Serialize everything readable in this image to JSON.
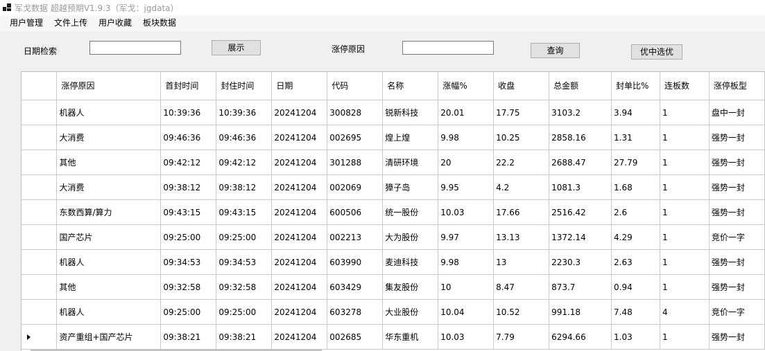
{
  "window": {
    "title": "军戈数据 超越预期V1.9.3（军戈：jgdata）"
  },
  "menu": {
    "items": [
      "用户管理",
      "文件上传",
      "用户收藏",
      "板块数据"
    ]
  },
  "search": {
    "date_label": "日期检索",
    "date_value": "",
    "show_button": "展示",
    "reason_label": "涨停原因",
    "reason_value": "",
    "query_button": "查询",
    "optimize_button": "优中选优"
  },
  "grid": {
    "columns": [
      "涨停原因",
      "首封时间",
      "封住时间",
      "日期",
      "代码",
      "名称",
      "涨幅%",
      "收盘",
      "总金额",
      "封单比%",
      "连板数",
      "涨停板型"
    ],
    "rows": [
      [
        "机器人",
        "10:39:36",
        "10:39:36",
        "20241204",
        "300828",
        "锐新科技",
        "20.01",
        "17.75",
        "3103.2",
        "3.94",
        "1",
        "盘中一封"
      ],
      [
        "大消费",
        "09:46:36",
        "09:46:36",
        "20241204",
        "002695",
        "煌上煌",
        "9.98",
        "10.25",
        "2858.16",
        "1.31",
        "1",
        "强势一封"
      ],
      [
        "其他",
        "09:42:12",
        "09:42:12",
        "20241204",
        "301288",
        "清研环境",
        "20",
        "22.2",
        "2688.47",
        "27.79",
        "1",
        "强势一封"
      ],
      [
        "大消费",
        "09:38:12",
        "09:38:12",
        "20241204",
        "002069",
        "獐子岛",
        "9.95",
        "4.2",
        "1081.3",
        "1.68",
        "1",
        "强势一封"
      ],
      [
        "东数西算/算力",
        "09:43:15",
        "09:43:15",
        "20241204",
        "600506",
        "统一股份",
        "10.03",
        "17.66",
        "2516.42",
        "2.6",
        "1",
        "强势一封"
      ],
      [
        "国产芯片",
        "09:25:00",
        "09:25:00",
        "20241204",
        "002213",
        "大为股份",
        "9.97",
        "13.13",
        "1372.14",
        "4.29",
        "1",
        "竞价一字"
      ],
      [
        "机器人",
        "09:34:53",
        "09:34:53",
        "20241204",
        "603990",
        "麦迪科技",
        "9.98",
        "13",
        "2230.3",
        "2.63",
        "1",
        "强势一封"
      ],
      [
        "其他",
        "09:32:58",
        "09:32:58",
        "20241204",
        "603429",
        "集友股份",
        "10",
        "8.47",
        "873.7",
        "0.94",
        "1",
        "强势一封"
      ],
      [
        "机器人",
        "09:25:00",
        "09:25:00",
        "20241204",
        "603278",
        "大业股份",
        "10.04",
        "10.52",
        "991.18",
        "7.48",
        "4",
        "竞价一字"
      ],
      [
        "资产重组+国产芯片",
        "09:38:21",
        "09:38:21",
        "20241204",
        "002685",
        "华东重机",
        "10.03",
        "7.79",
        "6294.66",
        "1.03",
        "1",
        "强势一封"
      ]
    ]
  }
}
